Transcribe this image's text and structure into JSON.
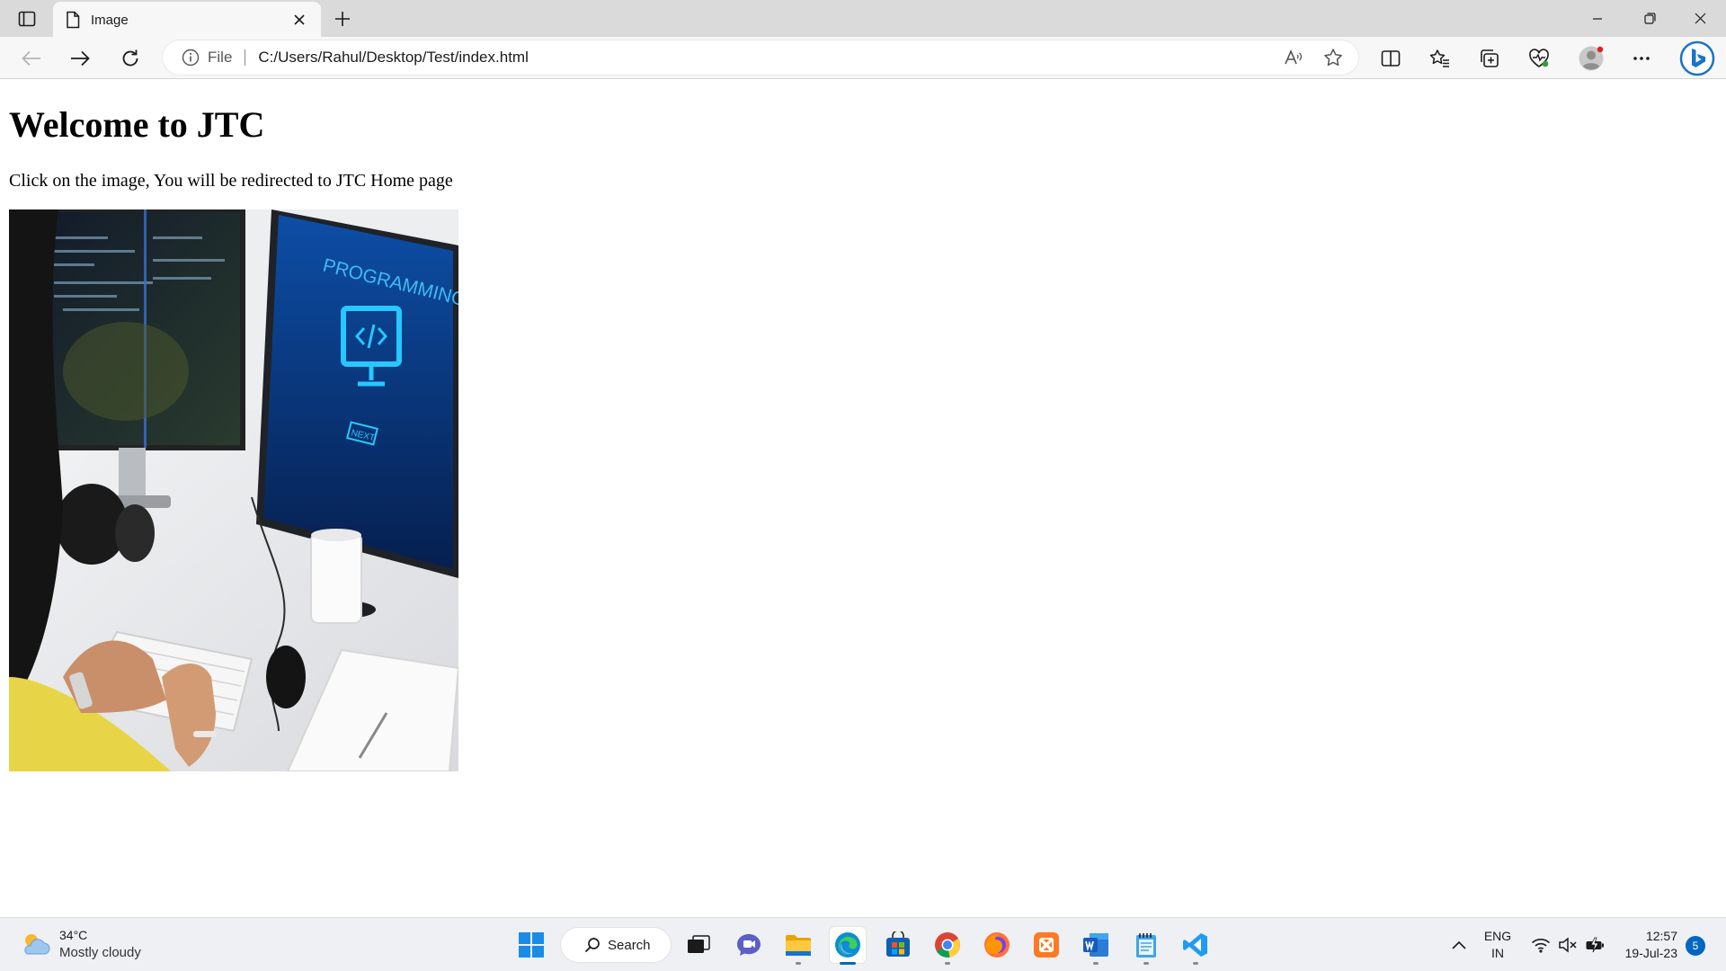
{
  "browser": {
    "tab": {
      "title": "Image",
      "icon": "page-icon"
    },
    "address_bar": {
      "scheme_label": "File",
      "url": "C:/Users/Rahul/Desktop/Test/index.html"
    },
    "window_controls": [
      "minimize-icon",
      "restore-icon",
      "close-icon"
    ]
  },
  "page": {
    "heading": "Welcome to JTC",
    "paragraph": "Click on the image, You will be redirected to JTC Home page",
    "image": {
      "screen_text": "PROGRAMMING",
      "button_text": "NEXT"
    }
  },
  "taskbar": {
    "weather": {
      "temp": "34°C",
      "desc": "Mostly cloudy"
    },
    "search_label": "Search",
    "language": {
      "line1": "ENG",
      "line2": "IN"
    },
    "clock": {
      "time": "12:57",
      "date": "19-Jul-23"
    },
    "notifications": "5",
    "colors": {
      "accent": "#0067c0"
    }
  }
}
